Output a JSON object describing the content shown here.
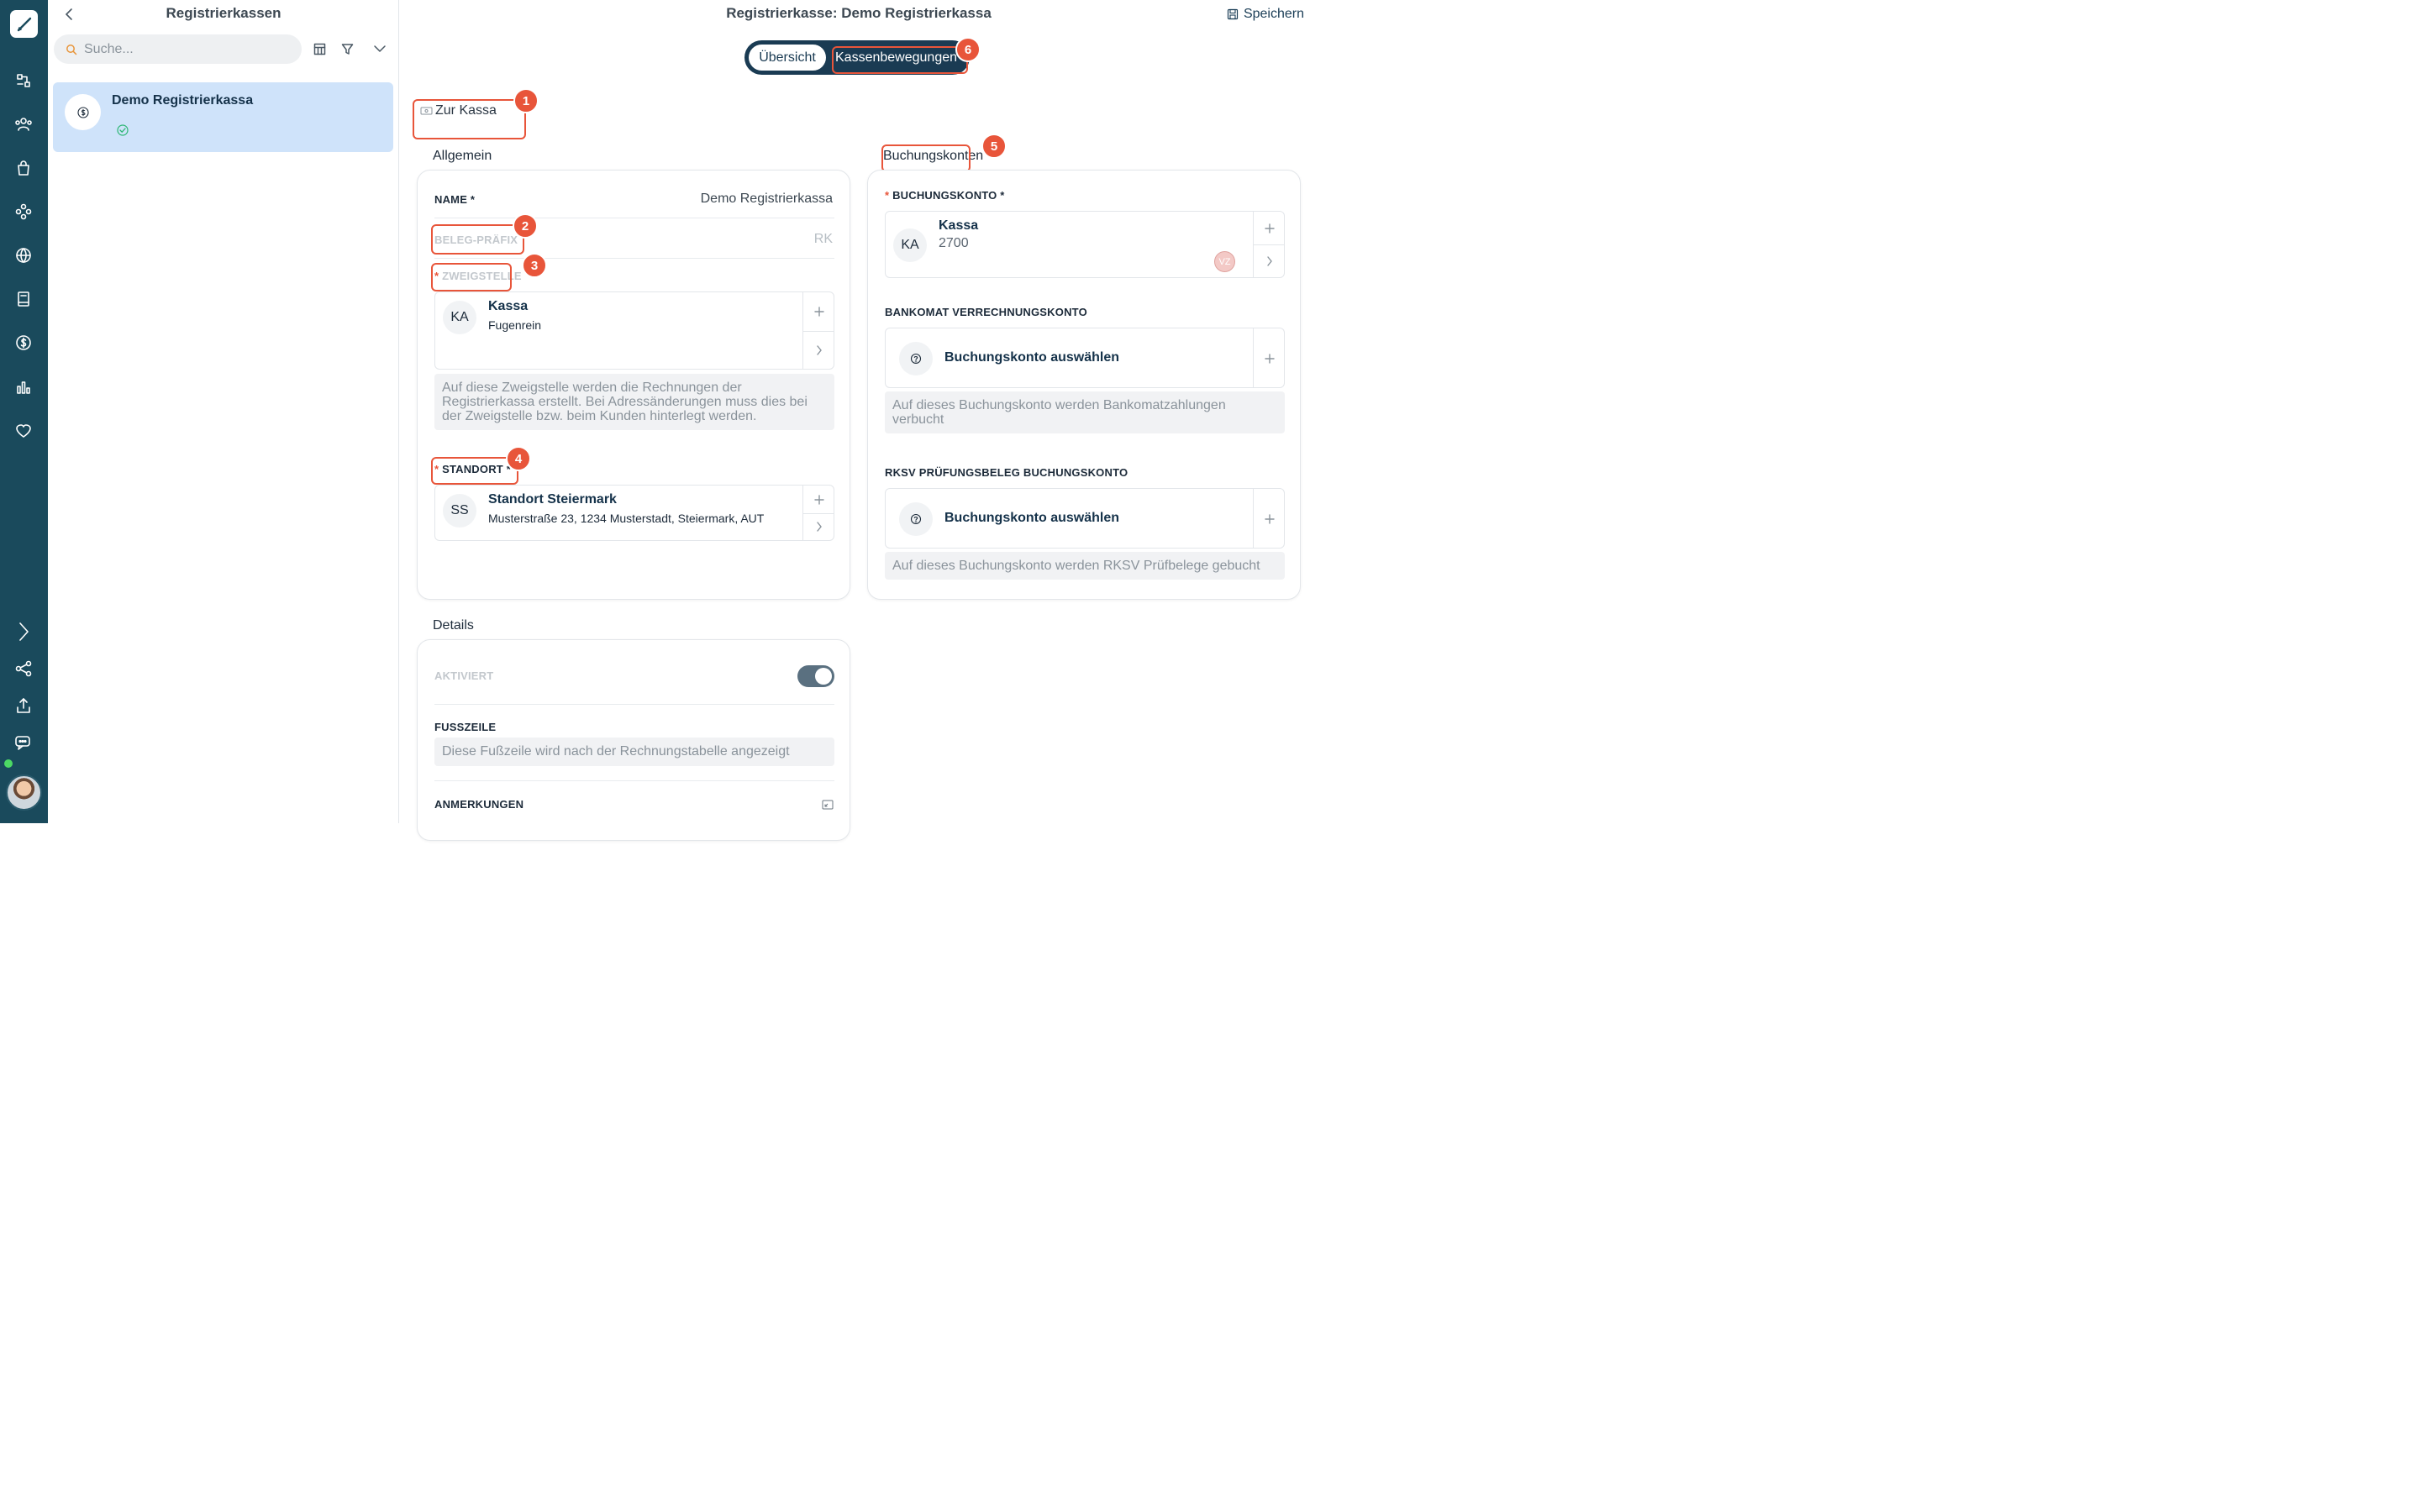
{
  "list": {
    "title": "Registrierkassen",
    "search_placeholder": "Suche...",
    "items": [
      {
        "name": "Demo Registrierkassa",
        "status": "aktiv"
      }
    ]
  },
  "main": {
    "title": "Registrierkasse: Demo Registrierkassa",
    "save_label": "Speichern",
    "tabs": [
      {
        "label": "Übersicht",
        "active": true
      },
      {
        "label": "Kassenbewegungen",
        "active": false
      }
    ],
    "zur_kassa": "Zur Kassa"
  },
  "annotations": [
    "1",
    "2",
    "3",
    "4",
    "5",
    "6"
  ],
  "allgemein": {
    "title": "Allgemein",
    "name_label": "NAME *",
    "name_value": "Demo Registrierkassa",
    "prefix_label": "BELEG-PRÄFIX",
    "prefix_value": "RK",
    "zweigstelle_label": "ZWEIGSTELLE",
    "zweigstelle": {
      "initials": "KA",
      "title": "Kassa",
      "subtitle": "Fugenrein"
    },
    "zweigstelle_hint": "Auf diese Zweigstelle werden die Rechnungen der Registrierkassa erstellt. Bei Adressänderungen muss dies bei der Zweigstelle bzw. beim Kunden hinterlegt werden.",
    "standort_label": "STANDORT *",
    "standort": {
      "initials": "SS",
      "title": "Standort Steiermark",
      "subtitle": "Musterstraße 23, 1234 Musterstadt, Steiermark, AUT"
    }
  },
  "buchung": {
    "title": "Buchungskonten",
    "konto_label": "BUCHUNGSKONTO *",
    "konto": {
      "initials": "KA",
      "title": "Kassa",
      "number": "2700",
      "tag": "VZ"
    },
    "bankomat_label": "BANKOMAT VERRECHNUNGSKONTO",
    "bankomat_select": "Buchungskonto auswählen",
    "bankomat_hint": "Auf dieses Buchungskonto werden Bankomatzahlungen verbucht",
    "rksv_label": "RKSV PRÜFUNGSBELEG BUCHUNGSKONTO",
    "rksv_select": "Buchungskonto auswählen",
    "rksv_hint": "Auf dieses Buchungskonto werden RKSV Prüfbelege gebucht"
  },
  "details": {
    "title": "Details",
    "aktiviert_label": "AKTIVIERT",
    "aktiviert": true,
    "fusszeile_label": "FUSSZEILE",
    "fusszeile_placeholder": "Diese Fußzeile wird nach der Rechnungstabelle angezeigt",
    "anmerkungen_label": "ANMERKUNGEN"
  },
  "colors": {
    "rail": "#1a4a5c",
    "accent": "#e8553a",
    "selected": "#cfe3fa",
    "segment": "#1a3b53"
  }
}
